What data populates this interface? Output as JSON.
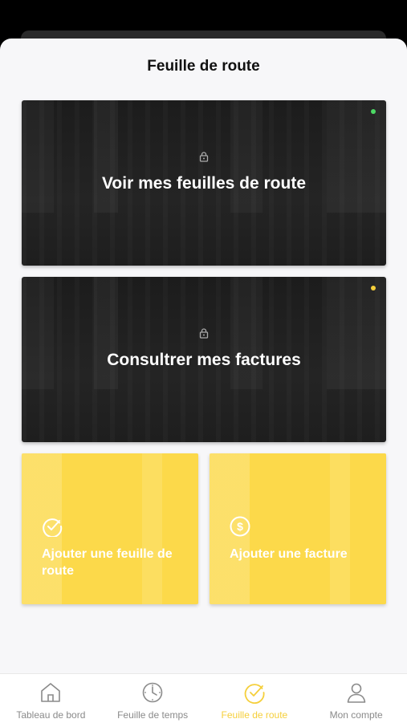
{
  "header": {
    "title": "Feuille de route"
  },
  "cards": [
    {
      "label": "Voir mes feuilles de route",
      "dot_color": "#4cd964"
    },
    {
      "label": "Consultrer mes factures",
      "dot_color": "#f5cf3b"
    }
  ],
  "tiles": [
    {
      "label": "Ajouter une feuille de route",
      "icon": "check-circle-icon"
    },
    {
      "label": "Ajouter une facture",
      "icon": "dollar-circle-icon"
    }
  ],
  "tabs": [
    {
      "label": "Tableau de bord",
      "icon": "home-icon"
    },
    {
      "label": "Feuille de temps",
      "icon": "clock-icon"
    },
    {
      "label": "Feuille de route",
      "icon": "check-circle-icon",
      "active": true
    },
    {
      "label": "Mon compte",
      "icon": "user-icon"
    }
  ],
  "colors": {
    "accent": "#f5cf3b",
    "tile_bg": "#fcd94a",
    "card_bg": "#1f1f1f",
    "inactive": "#8a8a8a"
  }
}
